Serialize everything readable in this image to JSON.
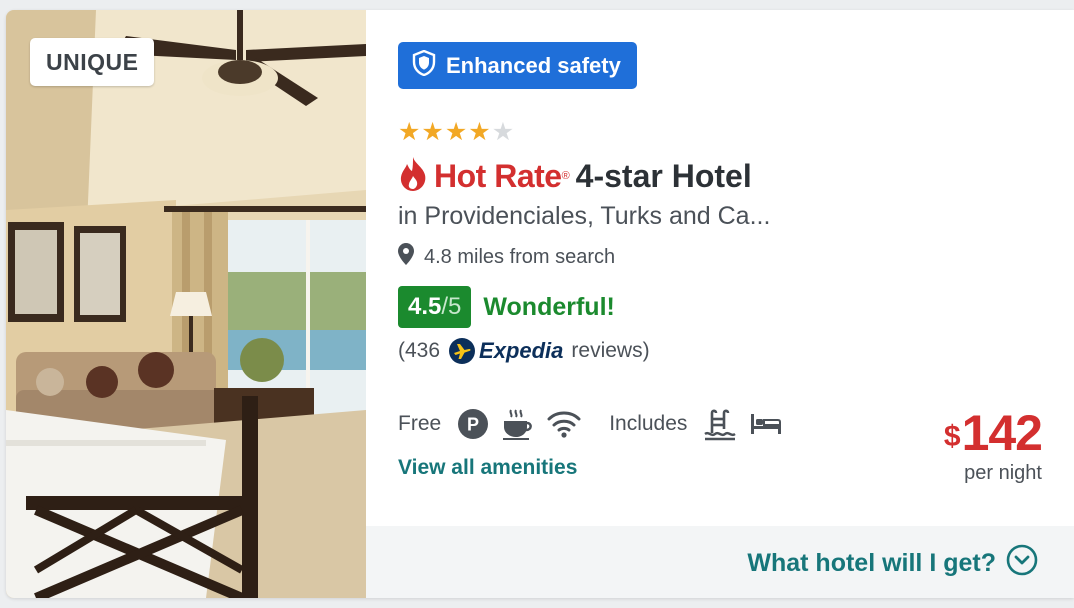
{
  "photo": {
    "badge_label": "UNIQUE"
  },
  "safety_badge": {
    "label": "Enhanced safety",
    "color": "#1f6fd9"
  },
  "rating_stars": {
    "filled": 4,
    "total": 5,
    "filled_color": "#f2a825"
  },
  "title": {
    "hot_rate_label": "Hot Rate",
    "registered_mark": "®",
    "hotel_class": "4-star Hotel",
    "accent_color": "#d32f2f"
  },
  "location": {
    "text": "in Providenciales, Turks and Ca...",
    "distance": "4.8 miles from search"
  },
  "guest_rating": {
    "score": "4.5",
    "out_of": "/5",
    "label": "Wonderful!",
    "color": "#1b8a2e"
  },
  "reviews": {
    "prefix": "(436",
    "source": "Expedia",
    "suffix": "reviews)"
  },
  "amenities": {
    "free_label": "Free",
    "free_icons": [
      "parking-icon",
      "coffee-icon",
      "wifi-icon"
    ],
    "includes_label": "Includes",
    "includes_icons": [
      "pool-icon",
      "bed-icon"
    ],
    "view_all_label": "View all amenities"
  },
  "price": {
    "currency": "$",
    "amount": "142",
    "unit": "per night"
  },
  "footer": {
    "link_label": "What hotel will I get?"
  }
}
